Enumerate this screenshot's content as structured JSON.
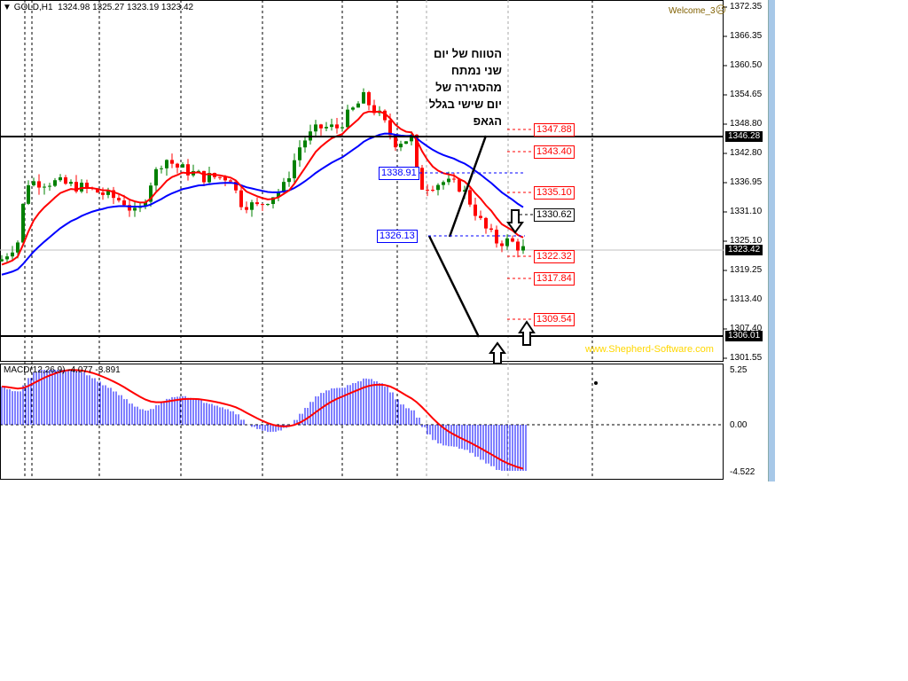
{
  "header": {
    "symbol": "GOLD,H1",
    "ohlc": "1324.98 1325.27 1323.19 1323.42",
    "account": "Welcome_3",
    "account_icon": "sad-face-icon",
    "account_glyph": "☹"
  },
  "price_axis": [
    "1372.35",
    "1366.35",
    "1360.50",
    "1354.65",
    "1348.80",
    "1342.80",
    "1336.95",
    "1331.10",
    "1325.10",
    "1319.25",
    "1313.40",
    "1307.40",
    "1301.55"
  ],
  "price_tags": {
    "upper_line": "1346.28",
    "current": "1323.42",
    "lower_line": "1306.01"
  },
  "levels_blue": [
    "1338.91",
    "1326.13"
  ],
  "levels_red": [
    "1347.88",
    "1343.40",
    "1335.10",
    "1322.32",
    "1317.84",
    "1309.54"
  ],
  "level_black": "1330.62",
  "annotation": [
    "הטווח של יום",
    "שני נמתח",
    "מהסגירה של",
    "יום שישי בגלל",
    "הגאפ"
  ],
  "watermark": "www.Shepherd-Software.com",
  "macd": {
    "label": "MACD(12,26,9) -4.077 -3.891",
    "axis": [
      "5.25",
      "0.00",
      "-4.522"
    ]
  },
  "colors": {
    "bull": "#008000",
    "bear": "#ff0000",
    "fast_ma": "#ff0000",
    "slow_ma": "#0000ff",
    "hist": "#0000ff",
    "signal": "#ff0000",
    "watermark": "#ffd700"
  },
  "price_path": [
    [
      0,
      1321
    ],
    [
      20,
      1325
    ],
    [
      30,
      1337
    ],
    [
      60,
      1337
    ],
    [
      90,
      1336
    ],
    [
      110,
      1335
    ],
    [
      140,
      1333
    ],
    [
      155,
      1330
    ],
    [
      170,
      1337
    ],
    [
      185,
      1342
    ],
    [
      200,
      1340
    ],
    [
      230,
      1338
    ],
    [
      260,
      1338
    ],
    [
      270,
      1333
    ],
    [
      290,
      1332
    ],
    [
      320,
      1336
    ],
    [
      340,
      1345
    ],
    [
      360,
      1348
    ],
    [
      380,
      1348
    ],
    [
      400,
      1352
    ],
    [
      410,
      1354
    ],
    [
      430,
      1350
    ],
    [
      445,
      1345
    ],
    [
      465,
      1346
    ],
    [
      472,
      1336
    ],
    [
      500,
      1337
    ],
    [
      520,
      1336
    ],
    [
      530,
      1333
    ],
    [
      545,
      1328
    ],
    [
      560,
      1325
    ],
    [
      575,
      1325
    ],
    [
      590,
      1323.4
    ]
  ]
}
